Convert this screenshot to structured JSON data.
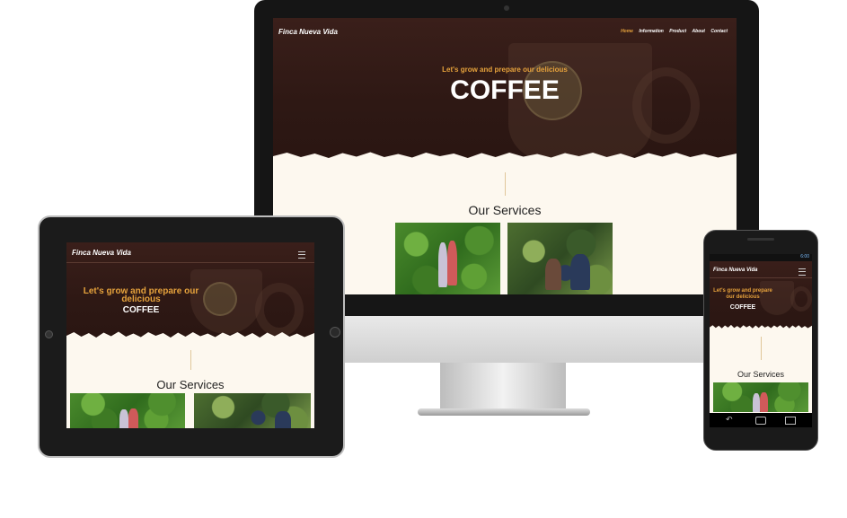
{
  "site": {
    "brand": "Finca Nueva Vida",
    "nav": [
      "Home",
      "Information",
      "Product",
      "About",
      "Contact"
    ],
    "tagline": "Let's grow and prepare our delicious",
    "headline": "COFFEE",
    "services_heading": "Our Services"
  },
  "colors": {
    "hero_bg": "#2e1814",
    "accent": "#e6a23c",
    "cream": "#fdf8ef",
    "device_frame": "#1a1a1a"
  },
  "icons": [
    "hamburger-menu-icon",
    "camera-dot-icon",
    "android-back-icon",
    "android-home-icon",
    "android-recent-icon"
  ],
  "phone_status": {
    "time": "6:00"
  }
}
